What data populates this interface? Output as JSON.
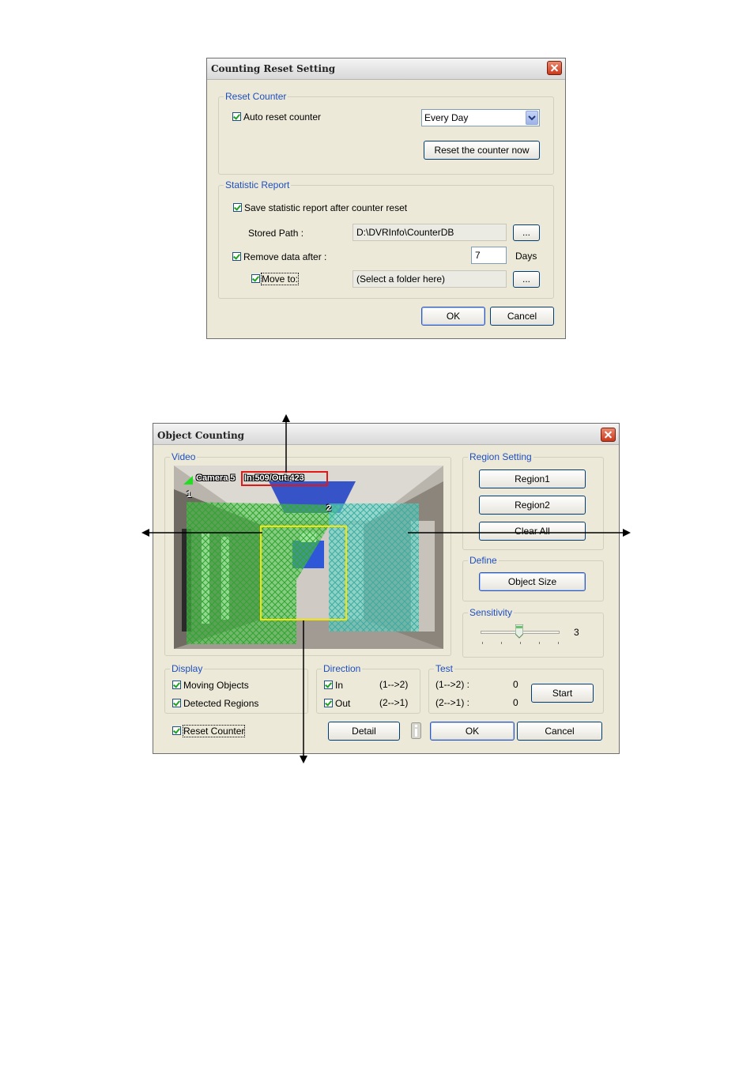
{
  "reset_dialog": {
    "title": "Counting Reset Setting",
    "reset_counter": {
      "group_label": "Reset Counter",
      "auto_reset_label": "Auto reset counter",
      "auto_reset_checked": true,
      "schedule_value": "Every Day",
      "reset_now_label": "Reset the counter now"
    },
    "statistic_report": {
      "group_label": "Statistic Report",
      "save_report_label": "Save statistic report after counter reset",
      "save_report_checked": true,
      "stored_path_label": "Stored Path :",
      "stored_path_value": "D:\\DVRInfo\\CounterDB",
      "browse_label": "...",
      "remove_data_label": "Remove data after :",
      "remove_days_value": "7",
      "days_unit": "Days",
      "move_to_label": "Move to:",
      "move_to_value": "(Select a folder here)"
    },
    "ok_label": "OK",
    "cancel_label": "Cancel"
  },
  "counting_dialog": {
    "title": "Object Counting",
    "video": {
      "group_label": "Video",
      "overlay_camera": "Camera 5",
      "overlay_count": "In:509/Out:423",
      "region_1_marker": "1",
      "region_2_marker": "2"
    },
    "region_setting": {
      "group_label": "Region Setting",
      "region1_label": "Region1",
      "region2_label": "Region2",
      "clear_all_label": "Clear All"
    },
    "define": {
      "group_label": "Define",
      "object_size_label": "Object Size"
    },
    "sensitivity": {
      "group_label": "Sensitivity",
      "value": "3"
    },
    "display": {
      "group_label": "Display",
      "moving_objects_label": "Moving Objects",
      "detected_regions_label": "Detected Regions"
    },
    "direction": {
      "group_label": "Direction",
      "in_label": "In",
      "in_dir": "(1-->2)",
      "out_label": "Out",
      "out_dir": "(2-->1)"
    },
    "test": {
      "group_label": "Test",
      "dir1_label": "(1-->2) :",
      "dir1_value": "0",
      "dir2_label": "(2-->1) :",
      "dir2_value": "0",
      "start_label": "Start"
    },
    "reset_counter_label": "Reset Counter",
    "detail_label": "Detail",
    "ok_label": "OK",
    "cancel_label": "Cancel"
  },
  "colors": {
    "group_label": "#1f4fbf",
    "region1_fill": "#4ecb4e",
    "region2_fill": "#5fd6c8",
    "count_box": "#e01818",
    "object_box": "#f2e600"
  }
}
